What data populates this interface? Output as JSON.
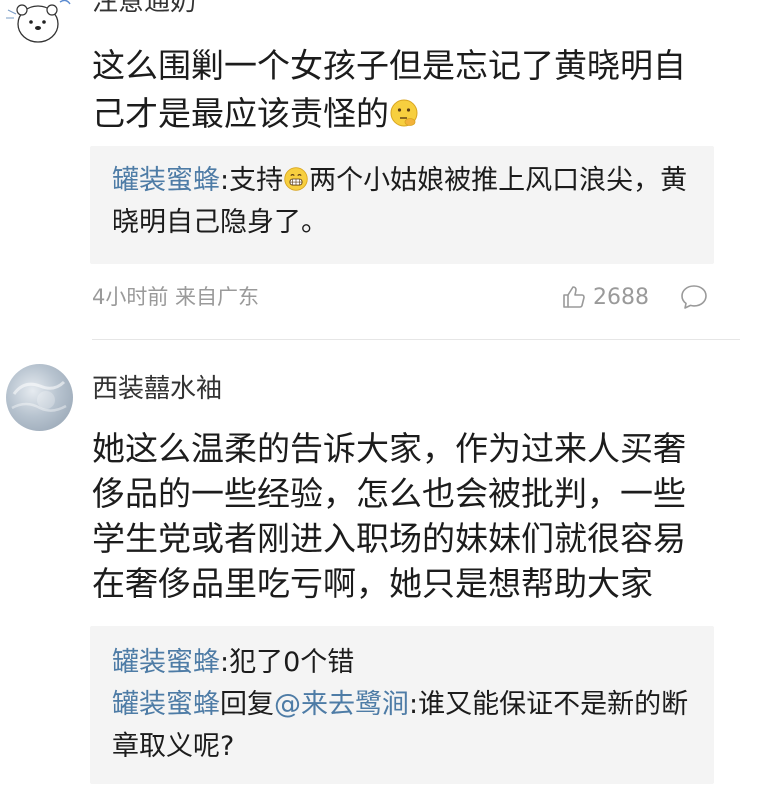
{
  "comment1": {
    "username": "注意通奶",
    "body": "这么围剿一个女孩子但是忘记了黄晓明自己才是最应该责怪的",
    "replies": [
      {
        "name": "罐装蜜蜂",
        "text1": ":支持",
        "text2": "两个小姑娘被推上风口浪尖，黄晓明自己隐身了。"
      }
    ],
    "time_source": "4小时前 来自广东",
    "likes": "2688"
  },
  "comment2": {
    "username": "西装囍水袖",
    "body": "她这么温柔的告诉大家，作为过来人买奢侈品的一些经验，怎么也会被批判，一些学生党或者刚进入职场的妹妹们就很容易在奢侈品里吃亏啊，她只是想帮助大家",
    "replies": [
      {
        "name": "罐装蜜蜂",
        "text": ":犯了0个错"
      },
      {
        "name": "罐装蜜蜂",
        "reply_word": "回复",
        "mention": "@来去鹭涧",
        "text": ":谁又能保证不是新的断章取义呢?"
      }
    ]
  },
  "icons": {
    "like": "thumbs-up-icon",
    "comment": "speech-bubble-icon",
    "emoji1": "thinking-face-emoji",
    "emoji2": "grinning-face-emoji"
  },
  "colors": {
    "reply_name": "#4e7ca6",
    "meta": "#9a9a9a",
    "reply_bg": "#f4f4f4"
  }
}
